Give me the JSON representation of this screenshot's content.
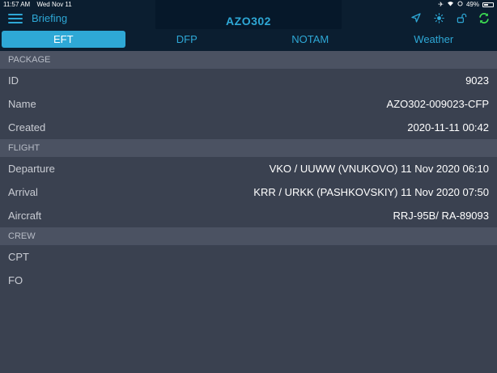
{
  "status_bar": {
    "time": "11:57 AM",
    "date": "Wed Nov 11",
    "battery": "49%",
    "battery_level": 0.49
  },
  "nav": {
    "back_label": "Briefing",
    "title": "AZO302",
    "icons": [
      "location-arrow-icon",
      "brightness-icon",
      "unlock-icon",
      "sync-icon"
    ],
    "accent_color": "#2ea8d6",
    "sync_color": "#3ddc52"
  },
  "tabs": [
    {
      "label": "EFT",
      "active": true
    },
    {
      "label": "DFP",
      "active": false
    },
    {
      "label": "NOTAM",
      "active": false
    },
    {
      "label": "Weather",
      "active": false
    }
  ],
  "sections": {
    "package": {
      "header": "PACKAGE",
      "rows": [
        {
          "label": "ID",
          "value": "9023"
        },
        {
          "label": "Name",
          "value": "AZO302-009023-CFP"
        },
        {
          "label": "Created",
          "value": "2020-11-11 00:42"
        }
      ]
    },
    "flight": {
      "header": "FLIGHT",
      "rows": [
        {
          "label": "Departure",
          "value": "VKO / UUWW (VNUKOVO) 11 Nov 2020 06:10"
        },
        {
          "label": "Arrival",
          "value": "KRR / URKK (PASHKOVSKIY) 11 Nov 2020 07:50"
        },
        {
          "label": "Aircraft",
          "value": "RRJ-95B/ RA-89093"
        }
      ]
    },
    "crew": {
      "header": "CREW",
      "rows": [
        {
          "label": "CPT",
          "value": ""
        },
        {
          "label": "FO",
          "value": ""
        }
      ]
    }
  }
}
